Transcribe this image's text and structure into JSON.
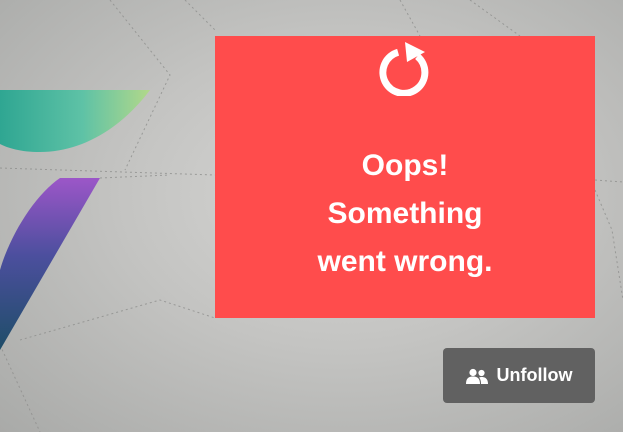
{
  "error_card": {
    "background_color": "#ff4c4c",
    "icon": "refresh-icon",
    "message": "Oops!\nSomething\nwent wrong."
  },
  "follow_button": {
    "icon": "users-icon",
    "label": "Unfollow",
    "background_color": "#616161"
  }
}
